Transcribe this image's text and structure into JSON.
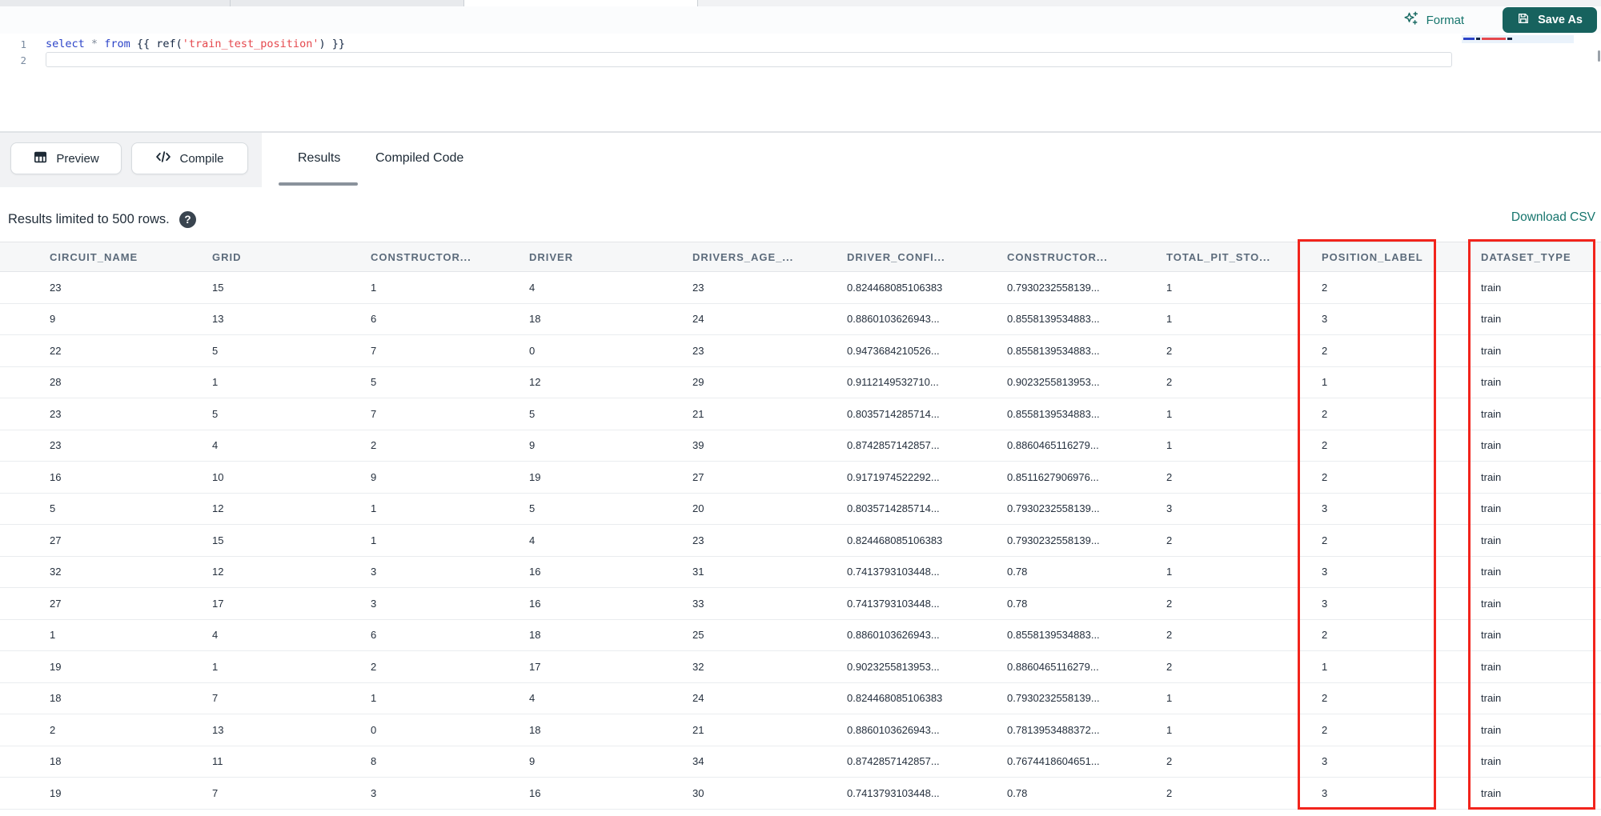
{
  "toolbar": {
    "format_label": "Format",
    "save_as_label": "Save As"
  },
  "editor": {
    "line_numbers": [
      "1",
      "2"
    ],
    "code_tokens": [
      {
        "text": "select",
        "type": "kw"
      },
      {
        "text": " ",
        "type": "plain"
      },
      {
        "text": "*",
        "type": "op"
      },
      {
        "text": " ",
        "type": "plain"
      },
      {
        "text": "from",
        "type": "kw"
      },
      {
        "text": " ",
        "type": "plain"
      },
      {
        "text": "{{ ",
        "type": "brace"
      },
      {
        "text": "ref(",
        "type": "fn"
      },
      {
        "text": "'train_test_position'",
        "type": "str"
      },
      {
        "text": ")",
        "type": "fn"
      },
      {
        "text": " }}",
        "type": "brace"
      }
    ]
  },
  "panel": {
    "preview_label": "Preview",
    "compile_label": "Compile",
    "tabs": [
      {
        "label": "Results",
        "active": true
      },
      {
        "label": "Compiled Code",
        "active": false
      }
    ]
  },
  "results": {
    "status_text": "Results limited to 500 rows.",
    "help_icon_glyph": "?",
    "download_label": "Download CSV",
    "columns": [
      "CIRCUIT_NAME",
      "GRID",
      "CONSTRUCTOR...",
      "DRIVER",
      "DRIVERS_AGE_...",
      "DRIVER_CONFI...",
      "CONSTRUCTOR...",
      "TOTAL_PIT_STO...",
      "POSITION_LABEL",
      "DATASET_TYPE"
    ],
    "rows": [
      [
        "23",
        "15",
        "1",
        "4",
        "23",
        "0.824468085106383",
        "0.7930232558139...",
        "1",
        "2",
        "train"
      ],
      [
        "9",
        "13",
        "6",
        "18",
        "24",
        "0.8860103626943...",
        "0.8558139534883...",
        "1",
        "3",
        "train"
      ],
      [
        "22",
        "5",
        "7",
        "0",
        "23",
        "0.9473684210526...",
        "0.8558139534883...",
        "2",
        "2",
        "train"
      ],
      [
        "28",
        "1",
        "5",
        "12",
        "29",
        "0.9112149532710...",
        "0.9023255813953...",
        "2",
        "1",
        "train"
      ],
      [
        "23",
        "5",
        "7",
        "5",
        "21",
        "0.8035714285714...",
        "0.8558139534883...",
        "1",
        "2",
        "train"
      ],
      [
        "23",
        "4",
        "2",
        "9",
        "39",
        "0.8742857142857...",
        "0.8860465116279...",
        "1",
        "2",
        "train"
      ],
      [
        "16",
        "10",
        "9",
        "19",
        "27",
        "0.9171974522292...",
        "0.8511627906976...",
        "2",
        "2",
        "train"
      ],
      [
        "5",
        "12",
        "1",
        "5",
        "20",
        "0.8035714285714...",
        "0.7930232558139...",
        "3",
        "3",
        "train"
      ],
      [
        "27",
        "15",
        "1",
        "4",
        "23",
        "0.824468085106383",
        "0.7930232558139...",
        "2",
        "2",
        "train"
      ],
      [
        "32",
        "12",
        "3",
        "16",
        "31",
        "0.7413793103448...",
        "0.78",
        "1",
        "3",
        "train"
      ],
      [
        "27",
        "17",
        "3",
        "16",
        "33",
        "0.7413793103448...",
        "0.78",
        "2",
        "3",
        "train"
      ],
      [
        "1",
        "4",
        "6",
        "18",
        "25",
        "0.8860103626943...",
        "0.8558139534883...",
        "2",
        "2",
        "train"
      ],
      [
        "19",
        "1",
        "2",
        "17",
        "32",
        "0.9023255813953...",
        "0.8860465116279...",
        "2",
        "1",
        "train"
      ],
      [
        "18",
        "7",
        "1",
        "4",
        "24",
        "0.824468085106383",
        "0.7930232558139...",
        "1",
        "2",
        "train"
      ],
      [
        "2",
        "13",
        "0",
        "18",
        "21",
        "0.8860103626943...",
        "0.7813953488372...",
        "1",
        "2",
        "train"
      ],
      [
        "18",
        "11",
        "8",
        "9",
        "34",
        "0.8742857142857...",
        "0.7674418604651...",
        "2",
        "3",
        "train"
      ],
      [
        "19",
        "7",
        "3",
        "16",
        "30",
        "0.7413793103448...",
        "0.78",
        "2",
        "3",
        "train"
      ]
    ],
    "highlighted_columns": [
      "POSITION_LABEL",
      "DATASET_TYPE"
    ]
  },
  "colors": {
    "accent_teal": "#17625E",
    "accent_link": "#16756D",
    "annotation_red": "#F2241C"
  }
}
